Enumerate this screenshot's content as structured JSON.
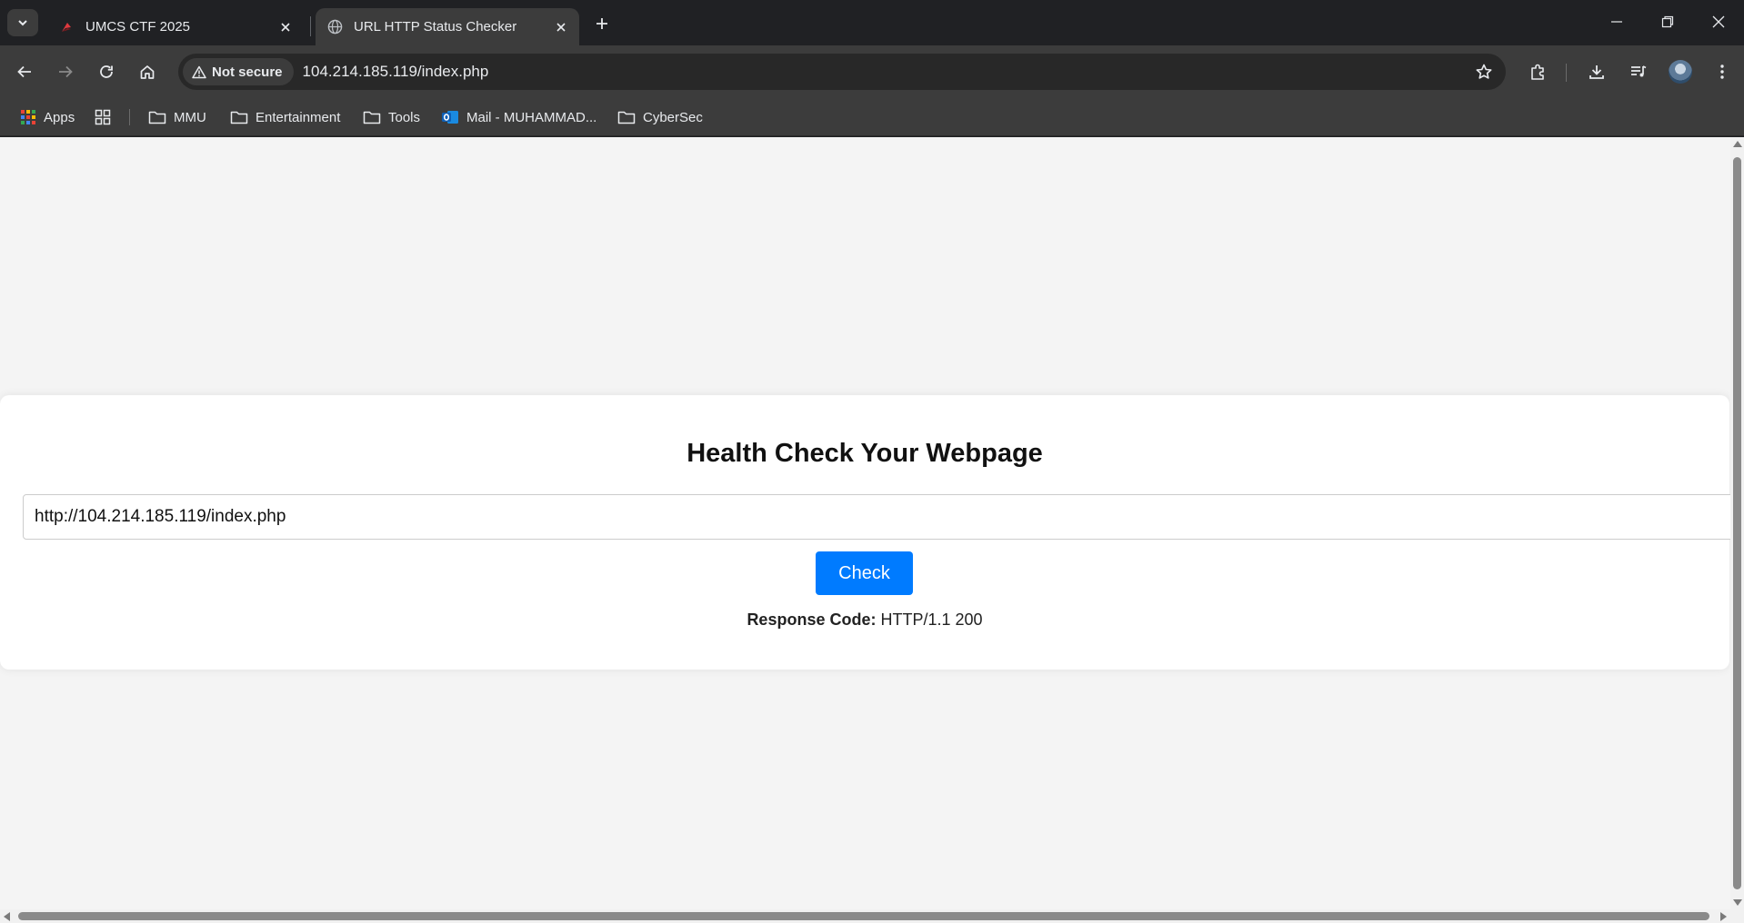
{
  "browser": {
    "tabs": [
      {
        "title": "UMCS CTF 2025",
        "active": false,
        "favicon": "umcs-flag-icon"
      },
      {
        "title": "URL HTTP Status Checker",
        "active": true,
        "favicon": "globe-icon"
      }
    ],
    "security_label": "Not secure",
    "address": "104.214.185.119/index.php",
    "bookmarks": [
      {
        "label": "Apps",
        "icon": "apps-grid-icon"
      },
      {
        "label": "",
        "icon": "tab-groups-icon"
      },
      {
        "label": "MMU",
        "icon": "folder-icon"
      },
      {
        "label": "Entertainment",
        "icon": "folder-icon"
      },
      {
        "label": "Tools",
        "icon": "folder-icon"
      },
      {
        "label": "Mail - MUHAMMAD...",
        "icon": "outlook-icon"
      },
      {
        "label": "CyberSec",
        "icon": "folder-icon"
      }
    ]
  },
  "page": {
    "title": "Health Check Your Webpage",
    "url_input_value": "http://104.214.185.119/index.php",
    "check_button": "Check",
    "response_label": "Response Code:",
    "response_value": "HTTP/1.1 200"
  },
  "colors": {
    "accent": "#007bff",
    "page_bg": "#f4f4f4",
    "chrome_dark": "#202124",
    "chrome_toolbar": "#3c3c3c"
  }
}
